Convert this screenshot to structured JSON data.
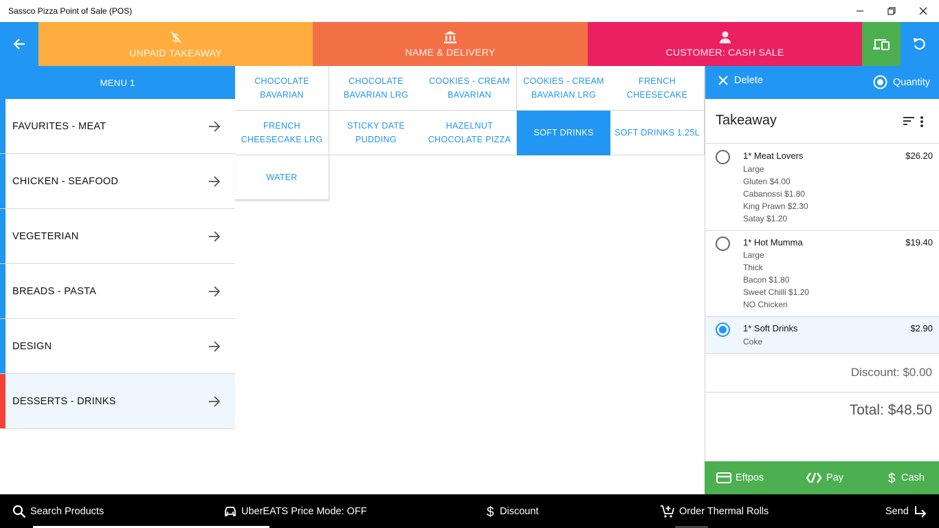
{
  "window": {
    "title": "Sassco Pizza Point of Sale (POS)"
  },
  "header": {
    "unpaid_label": "UNPAID TAKEAWAY",
    "name_label": "NAME & DELIVERY",
    "customer_label": "CUSTOMER: CASH SALE"
  },
  "menu": {
    "title": "MENU 1",
    "categories": [
      {
        "label": "FAVURITES - MEAT"
      },
      {
        "label": "CHICKEN - SEAFOOD"
      },
      {
        "label": "VEGETERIAN"
      },
      {
        "label": "BREADS - PASTA"
      },
      {
        "label": "DESIGN"
      },
      {
        "label": "DESSERTS - DRINKS"
      }
    ]
  },
  "products": [
    {
      "label": "CHOCOLATE BAVARIAN"
    },
    {
      "label": "CHOCOLATE BAVARIAN LRG"
    },
    {
      "label": "COOKIES - CREAM BAVARIAN"
    },
    {
      "label": "COOKIES - CREAM BAVARIAN LRG"
    },
    {
      "label": "FRENCH CHEESECAKE"
    },
    {
      "label": "FRENCH CHEESECAKE LRG"
    },
    {
      "label": "STICKY DATE PUDDING"
    },
    {
      "label": "HAZELNUT CHOCOLATE PIZZA"
    },
    {
      "label": "SOFT DRINKS"
    },
    {
      "label": "SOFT DRINKS 1.25L"
    },
    {
      "label": "WATER"
    }
  ],
  "order": {
    "delete_label": "Delete",
    "quantity_label": "Quantity",
    "title": "Takeaway",
    "items": [
      {
        "name": "1* Meat Lovers",
        "price": "$26.20",
        "mods": [
          "Large",
          "Gluten $4.00",
          "Cabanossi $1.80",
          "King Prawn $2.30",
          "Satay $1.20"
        ]
      },
      {
        "name": "1* Hot Mumma",
        "price": "$19.40",
        "mods": [
          "Large",
          "Thick",
          "Bacon $1.80",
          "Sweet Chilli $1.20",
          "NO Chicken"
        ]
      },
      {
        "name": "1* Soft Drinks",
        "price": "$2.90",
        "mods": [
          "Coke"
        ]
      }
    ],
    "discount": "Discount: $0.00",
    "total": "Total: $48.50",
    "payment": {
      "eftpos": "Eftpos",
      "pay": "Pay",
      "cash": "Cash"
    }
  },
  "bottom": {
    "search": "Search Products",
    "uber": "UberEATS Price Mode: OFF",
    "discount": "Discount",
    "thermal": "Order Thermal Rolls",
    "send": "Send"
  },
  "colors": {
    "blue": "#2196f3",
    "orange": "#ffad3f",
    "coral": "#f37046",
    "pink": "#eb2062",
    "green": "#4caf50",
    "red": "#f44336"
  }
}
